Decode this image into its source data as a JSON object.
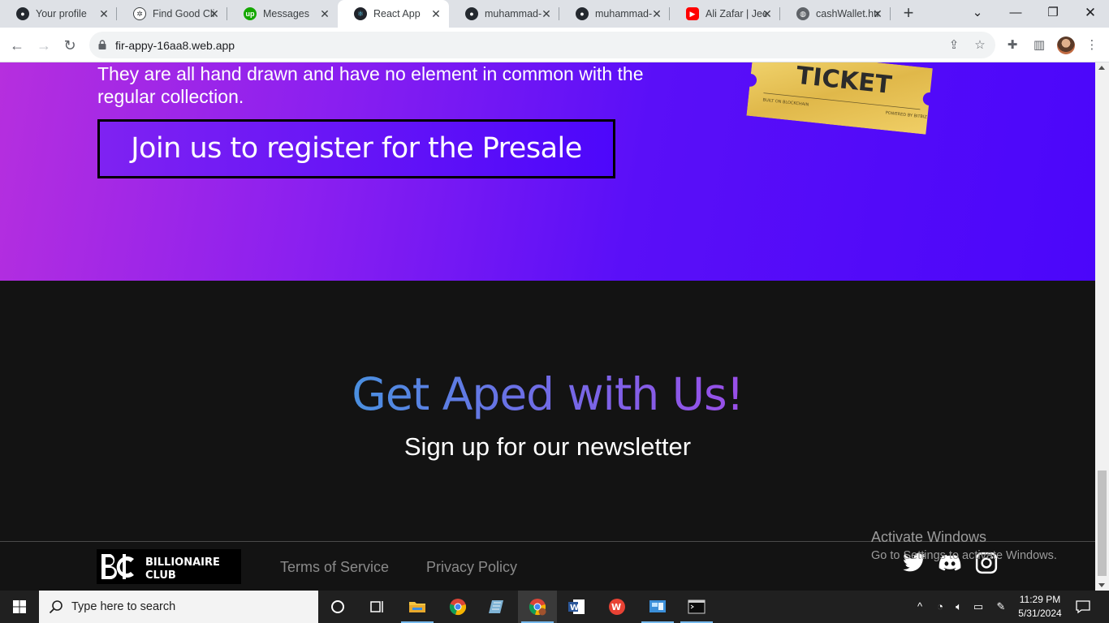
{
  "browser": {
    "tabs": [
      {
        "title": "Your profile",
        "favicon": "github-icon"
      },
      {
        "title": "Find Good Cli",
        "favicon": "openai-icon"
      },
      {
        "title": "Messages",
        "favicon": "upwork-icon"
      },
      {
        "title": "React App",
        "favicon": "react-icon",
        "active": true
      },
      {
        "title": "muhammad-",
        "favicon": "github-icon"
      },
      {
        "title": "muhammad-",
        "favicon": "github-icon"
      },
      {
        "title": "Ali Zafar | Jee",
        "favicon": "youtube-icon"
      },
      {
        "title": "cashWallet.htr",
        "favicon": "globe-icon"
      }
    ],
    "url": "fir-appy-16aa8.web.app"
  },
  "hero": {
    "description": "They are all hand drawn and have no element in common with the regular collection.",
    "presale_button": "Join us to register for the Presale",
    "ticket_label": "TICKET",
    "ticket_small_left": "BUILT ON BLOCKCHAIN",
    "ticket_small_right": "POWERED BY BITBIZ"
  },
  "newsletter": {
    "title": "Get Aped with Us!",
    "subtitle": "Sign up for our newsletter"
  },
  "footer": {
    "logo_line1": "BILLIONAIRE",
    "logo_line2": "CLUB",
    "terms": "Terms of Service",
    "privacy": "Privacy Policy",
    "socials": [
      "twitter-icon",
      "discord-icon",
      "instagram-icon"
    ]
  },
  "watermark": {
    "line1": "Activate Windows",
    "line2": "Go to Settings to activate Windows."
  },
  "taskbar": {
    "search_placeholder": "Type here to search",
    "time": "11:29 PM",
    "date": "5/31/2024"
  },
  "colors": {
    "hero_gradient_start": "#b62fde",
    "hero_gradient_end": "#4b06fa",
    "page_dark": "#131313",
    "title_gradient_start": "#4a90e0",
    "title_gradient_end": "#9a4ee8"
  }
}
